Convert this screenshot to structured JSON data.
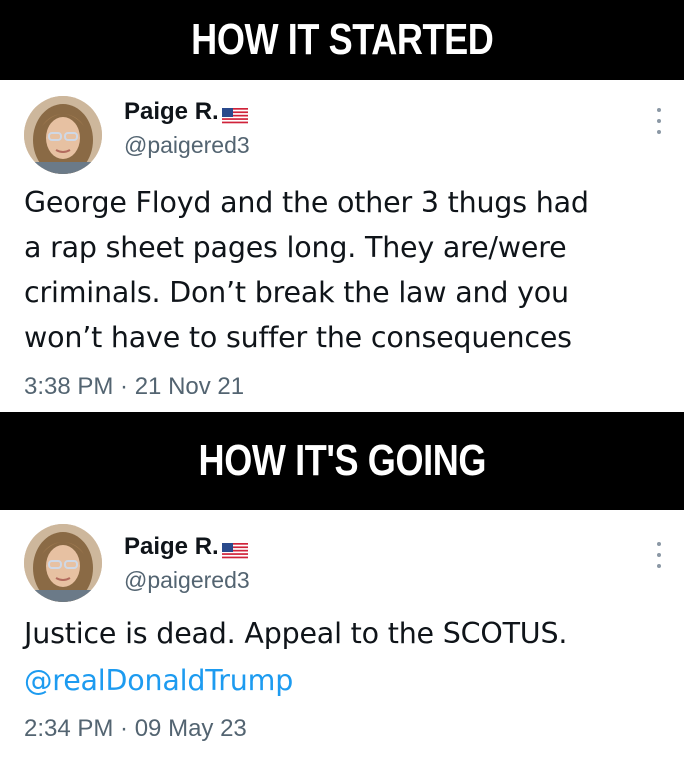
{
  "banners": {
    "top": "HOW IT STARTED",
    "middle": "HOW IT'S GOING"
  },
  "tweets": [
    {
      "display_name": "Paige R.",
      "handle": "@paigered3",
      "text_lines": [
        "George Floyd and the other 3 thugs had",
        "a rap sheet pages long. They are/were",
        "criminals. Don’t break the law and you",
        "won’t have to suffer the consequences"
      ],
      "timestamp": "3:38 PM · 21 Nov 21"
    },
    {
      "display_name": "Paige R.",
      "handle": "@paigered3",
      "text_lines": [
        "Justice is dead. Appeal to the SCOTUS."
      ],
      "mention": "@realDonaldTrump",
      "timestamp": "2:34 PM · 09 May 23"
    }
  ],
  "colors": {
    "banner_bg": "#000000",
    "banner_text": "#ffffff",
    "link": "#1d9bf0",
    "secondary_text": "#536471"
  },
  "icons": {
    "flag": "us-flag-icon",
    "more": "more-options-icon"
  }
}
